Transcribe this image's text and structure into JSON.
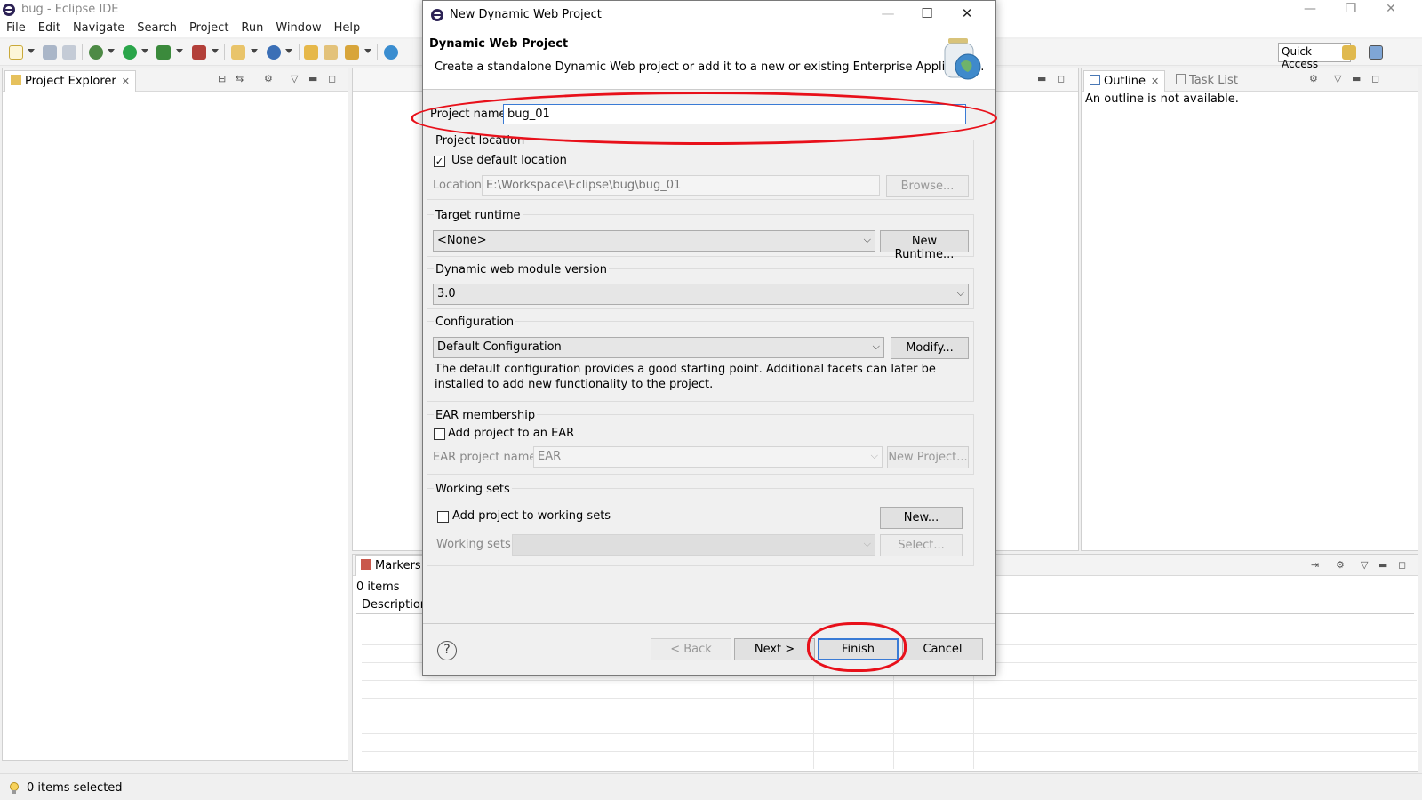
{
  "window": {
    "title": "bug - Eclipse IDE"
  },
  "menu": [
    "File",
    "Edit",
    "Navigate",
    "Search",
    "Project",
    "Run",
    "Window",
    "Help"
  ],
  "toolbar": {
    "quick_access": "Quick Access"
  },
  "project_explorer": {
    "tab_label": "Project Explorer"
  },
  "outline": {
    "tab_label": "Outline",
    "task_list_label": "Task List",
    "message": "An outline is not available."
  },
  "markers": {
    "tab_label": "Markers",
    "count_text": "0 items",
    "column_description": "Description"
  },
  "status": {
    "text": "0 items selected"
  },
  "dialog": {
    "title": "New Dynamic Web Project",
    "heading": "Dynamic Web Project",
    "description": "Create a standalone Dynamic Web project or add it to a new or existing Enterprise Application.",
    "project_name_label": "Project name:",
    "project_name_value": "bug_01",
    "project_location_label": "Project location",
    "use_default_location_label": "Use default location",
    "use_default_location_checked": true,
    "location_label": "Location:",
    "location_value": "E:\\Workspace\\Eclipse\\bug\\bug_01",
    "browse_button": "Browse...",
    "target_runtime_label": "Target runtime",
    "target_runtime_value": "<None>",
    "new_runtime_button": "New Runtime...",
    "module_version_label": "Dynamic web module version",
    "module_version_value": "3.0",
    "configuration_label": "Configuration",
    "configuration_value": "Default Configuration",
    "modify_button": "Modify...",
    "configuration_desc": "The default configuration provides a good starting point. Additional facets can later be installed to add new functionality to the project.",
    "ear_label": "EAR membership",
    "add_to_ear_label": "Add project to an EAR",
    "add_to_ear_checked": false,
    "ear_project_name_label": "EAR project name:",
    "ear_project_name_value": "EAR",
    "new_project_button": "New Project...",
    "working_sets_label": "Working sets",
    "add_to_working_sets_label": "Add project to working sets",
    "add_to_working_sets_checked": false,
    "new_button": "New...",
    "working_sets_field_label": "Working sets:",
    "select_button": "Select...",
    "back_button": "< Back",
    "next_button": "Next >",
    "finish_button": "Finish",
    "cancel_button": "Cancel",
    "help_symbol": "?"
  },
  "colors": {
    "annotation": "#e8101a",
    "focus_border": "#3a7bd5"
  }
}
